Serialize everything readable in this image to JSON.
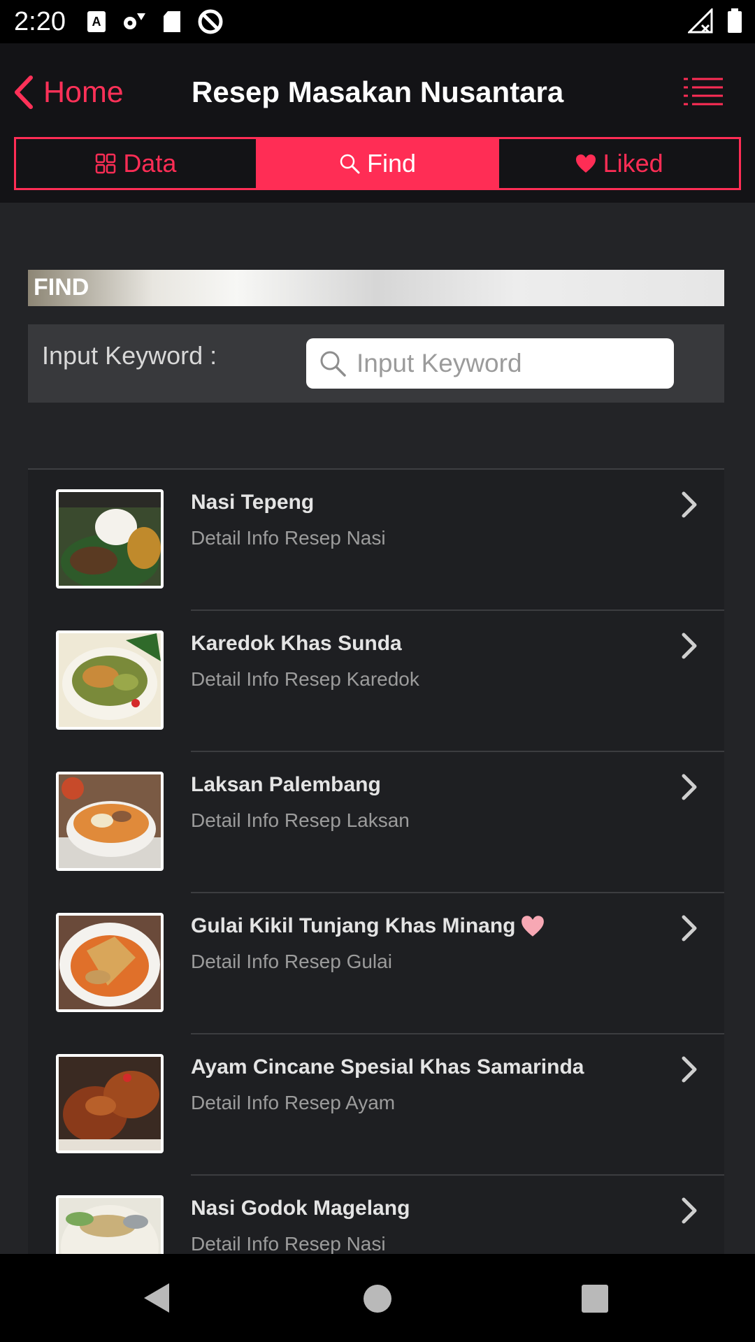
{
  "status_bar": {
    "time": "2:20",
    "icons_left": [
      "keyboard-a-icon",
      "settings-gear-icon",
      "sd-card-icon",
      "no-disturb-icon"
    ],
    "icons_right": [
      "signal-no-data-icon",
      "battery-icon"
    ]
  },
  "header": {
    "back_label": "Home",
    "title": "Resep Masakan Nusantara",
    "menu_icon": "list-menu-icon",
    "accent_color": "#ff2d55"
  },
  "tabs": [
    {
      "label": "Data",
      "icon": "grid-icon",
      "active": false
    },
    {
      "label": "Find",
      "icon": "search-icon",
      "active": true
    },
    {
      "label": "Liked",
      "icon": "heart-icon",
      "active": false
    }
  ],
  "find": {
    "section_title": "FIND",
    "keyword_label": "Input Keyword :",
    "search_placeholder": "Input Keyword",
    "search_value": ""
  },
  "recipes": [
    {
      "title": "Nasi Tepeng",
      "subtitle": "Detail Info Resep Nasi",
      "liked": false,
      "thumb": "nasi-tepeng-photo"
    },
    {
      "title": "Karedok Khas Sunda",
      "subtitle": "Detail Info Resep Karedok",
      "liked": false,
      "thumb": "karedok-photo"
    },
    {
      "title": "Laksan Palembang",
      "subtitle": "Detail Info Resep Laksan",
      "liked": false,
      "thumb": "laksan-photo"
    },
    {
      "title": "Gulai Kikil Tunjang Khas Minang",
      "subtitle": "Detail Info Resep Gulai",
      "liked": true,
      "thumb": "gulai-photo"
    },
    {
      "title": "Ayam Cincane Spesial Khas Samarinda",
      "subtitle": "Detail Info Resep Ayam",
      "liked": false,
      "thumb": "ayam-photo"
    },
    {
      "title": "Nasi Godok Magelang",
      "subtitle": "Detail Info Resep Nasi",
      "liked": false,
      "thumb": "nasi-godok-photo"
    }
  ],
  "navigation_bar": [
    "back-icon",
    "home-icon",
    "recents-icon"
  ]
}
